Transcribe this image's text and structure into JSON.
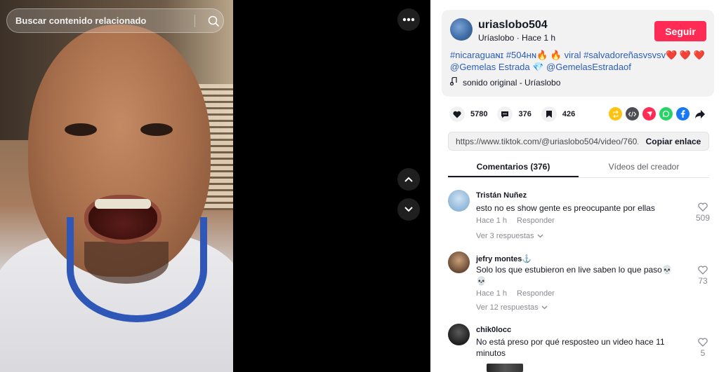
{
  "search": {
    "placeholder": "Buscar contenido relacionado"
  },
  "author": {
    "username": "uriaslobo504",
    "display": "Uríaslobo · Hace 1 h",
    "follow_label": "Seguir"
  },
  "caption": {
    "line1": "#nicaraguaɴɪ #504ʜɴ🔥 🔥 viral #salvadoreñasvsvsv❤️ ❤️ ❤️",
    "line2": "@Gemelas Estrada 💎 @GemelasEstradaof"
  },
  "sound": {
    "label": "sonido original - Uríaslobo"
  },
  "stats": {
    "likes": "5780",
    "comments": "376",
    "saves": "426"
  },
  "share_icons": [
    "repost-icon",
    "embed-icon",
    "send-icon",
    "whatsapp-icon",
    "facebook-icon",
    "share-arrow-icon"
  ],
  "link": {
    "url": "https://www.tiktok.com/@uriaslobo504/video/760...",
    "copy_label": "Copiar enlace"
  },
  "tabs": [
    {
      "label": "Comentarios (376)",
      "active": true
    },
    {
      "label": "Vídeos del creador",
      "active": false
    }
  ],
  "comments": [
    {
      "name": "Tristán Nuñez",
      "text": "esto no es show gente es preocupante por ellas",
      "time": "Hace 1 h",
      "reply_label": "Responder",
      "replies": "Ver 3 respuestas",
      "likes": "509"
    },
    {
      "name": "jefry montes⚓",
      "text": "Solo los que estubieron en live saben lo que paso💀 💀",
      "time": "Hace 1 h",
      "reply_label": "Responder",
      "replies": "Ver 12 respuestas",
      "likes": "73"
    },
    {
      "name": "chik0locc",
      "text": "No está preso por qué resposteo un video hace 11 minutos",
      "likes": "5"
    }
  ],
  "colors": {
    "accent": "#fe2c55",
    "link": "#2b5db9"
  }
}
